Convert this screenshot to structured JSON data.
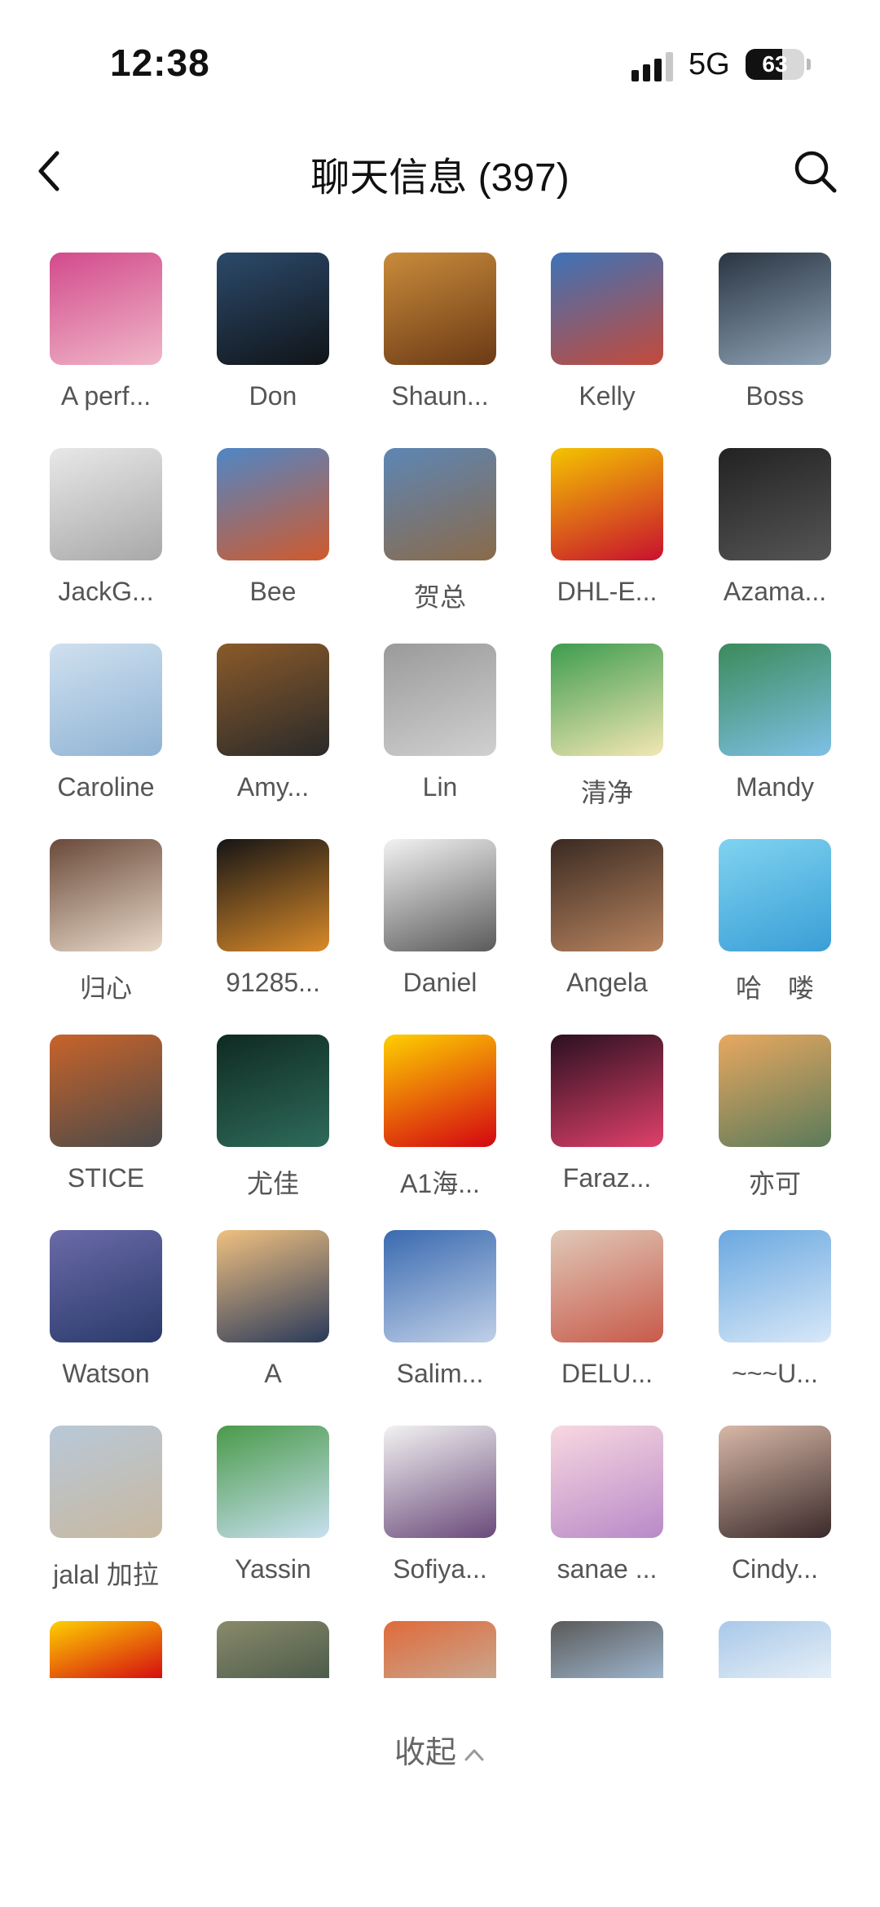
{
  "status_bar": {
    "time": "12:38",
    "network": "5G",
    "battery": "63",
    "battery_level": 0.63
  },
  "header": {
    "title": "聊天信息 (397)",
    "back_icon": "chevron-left-icon",
    "search_icon": "search-icon"
  },
  "members": [
    {
      "name": "A perf...",
      "avatar_color": "#d24a8c",
      "avatar_color2": "#f0b7c8"
    },
    {
      "name": "Don",
      "avatar_color": "#2c4a6b",
      "avatar_color2": "#101418"
    },
    {
      "name": "Shaun...",
      "avatar_color": "#c98b3b",
      "avatar_color2": "#6b3a15"
    },
    {
      "name": "Kelly",
      "avatar_color": "#3d73b8",
      "avatar_color2": "#c44a3a"
    },
    {
      "name": "Boss",
      "avatar_color": "#2a3542",
      "avatar_color2": "#8fa3b6"
    },
    {
      "name": "JackG...",
      "avatar_color": "#e8e8e8",
      "avatar_color2": "#a8a8a8"
    },
    {
      "name": "Bee",
      "avatar_color": "#4f86c6",
      "avatar_color2": "#d05a2c"
    },
    {
      "name": "贺总",
      "avatar_color": "#5d86b5",
      "avatar_color2": "#8a6a4a"
    },
    {
      "name": "DHL-E...",
      "avatar_color": "#f4c400",
      "avatar_color2": "#c8102e"
    },
    {
      "name": "Azama...",
      "avatar_color": "#222222",
      "avatar_color2": "#555555"
    },
    {
      "name": "Caroline",
      "avatar_color": "#cfe0ef",
      "avatar_color2": "#8fb3d4"
    },
    {
      "name": "Amy...",
      "avatar_color": "#8a5a2a",
      "avatar_color2": "#2a2a2a"
    },
    {
      "name": "Lin",
      "avatar_color": "#9a9a9a",
      "avatar_color2": "#d0d0d0"
    },
    {
      "name": "清净",
      "avatar_color": "#3e9c4f",
      "avatar_color2": "#f3e7b3"
    },
    {
      "name": "Mandy",
      "avatar_color": "#3b8a5a",
      "avatar_color2": "#7fc0e6"
    },
    {
      "name": "归心",
      "avatar_color": "#6a4a3a",
      "avatar_color2": "#e8d8c8"
    },
    {
      "name": "91285...",
      "avatar_color": "#151515",
      "avatar_color2": "#d98a2a"
    },
    {
      "name": "Daniel",
      "avatar_color": "#f2f2f2",
      "avatar_color2": "#5a5a5a"
    },
    {
      "name": "Angela",
      "avatar_color": "#3a2a22",
      "avatar_color2": "#b8845f"
    },
    {
      "name": "哈　喽",
      "avatar_color": "#7fd3f0",
      "avatar_color2": "#3a9ed6"
    },
    {
      "name": "STICE",
      "avatar_color": "#c8632a",
      "avatar_color2": "#4a4a4a"
    },
    {
      "name": "尤佳",
      "avatar_color": "#0f2a22",
      "avatar_color2": "#2e6b5a"
    },
    {
      "name": "A1海...",
      "avatar_color": "#fdd000",
      "avatar_color2": "#d40511"
    },
    {
      "name": "Faraz...",
      "avatar_color": "#2a1020",
      "avatar_color2": "#e0406a"
    },
    {
      "name": "亦可",
      "avatar_color": "#e8a860",
      "avatar_color2": "#5a7a5a"
    },
    {
      "name": "Watson",
      "avatar_color": "#6a6aa8",
      "avatar_color2": "#2a3a6a"
    },
    {
      "name": "A",
      "avatar_color": "#f0c080",
      "avatar_color2": "#2a3a5a"
    },
    {
      "name": "Salim...",
      "avatar_color": "#3a6ab0",
      "avatar_color2": "#c0d0e8"
    },
    {
      "name": "DELU...",
      "avatar_color": "#e0c8b8",
      "avatar_color2": "#c85a4a"
    },
    {
      "name": "~~~U...",
      "avatar_color": "#6aa8e0",
      "avatar_color2": "#d8e8f8"
    },
    {
      "name": "jalal 加拉",
      "avatar_color": "#b8c8d8",
      "avatar_color2": "#c8b8a0"
    },
    {
      "name": "Yassin",
      "avatar_color": "#4a9a4a",
      "avatar_color2": "#c8e0f0"
    },
    {
      "name": "Sofiya...",
      "avatar_color": "#f2f2f2",
      "avatar_color2": "#6a4a7a"
    },
    {
      "name": "sanae ...",
      "avatar_color": "#f8d8e0",
      "avatar_color2": "#b88ac8"
    },
    {
      "name": "Cindy...",
      "avatar_color": "#d8b8a8",
      "avatar_color2": "#3a2a2a"
    },
    {
      "name": "",
      "avatar_color": "#fdd000",
      "avatar_color2": "#d40511"
    },
    {
      "name": "",
      "avatar_color": "#8a8a6a",
      "avatar_color2": "#4a5a4a"
    },
    {
      "name": "",
      "avatar_color": "#e06a3a",
      "avatar_color2": "#c8a890"
    },
    {
      "name": "",
      "avatar_color": "#5a5a5a",
      "avatar_color2": "#a0b8d0"
    },
    {
      "name": "",
      "avatar_color": "#a8c8e8",
      "avatar_color2": "#e8f0f8"
    }
  ],
  "collapse": {
    "label": "收起"
  }
}
